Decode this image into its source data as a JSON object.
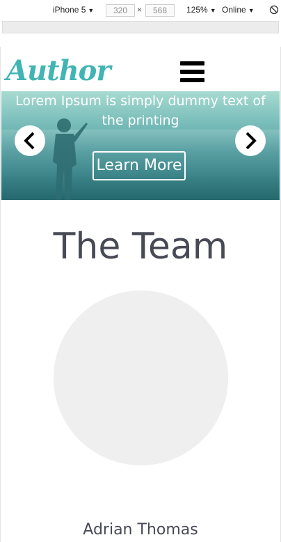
{
  "devtools": {
    "device": "iPhone 5",
    "width": "320",
    "times": "×",
    "height": "568",
    "zoom": "125%",
    "network": "Online",
    "caret": "▼",
    "rotate_icon": "rotate-icon"
  },
  "site": {
    "logo": "Author",
    "menu_icon": "hamburger-menu-icon"
  },
  "carousel": {
    "caption": "Lorem Ipsum is simply dummy text of the printing",
    "button": "Learn More",
    "prev_icon": "chevron-left-icon",
    "next_icon": "chevron-right-icon"
  },
  "team": {
    "title": "The Team",
    "members": [
      {
        "name": "Adrian Thomas"
      }
    ]
  },
  "colors": {
    "logo": "#41b4b4",
    "heading": "#474a55",
    "avatar_placeholder": "#efeff0"
  }
}
